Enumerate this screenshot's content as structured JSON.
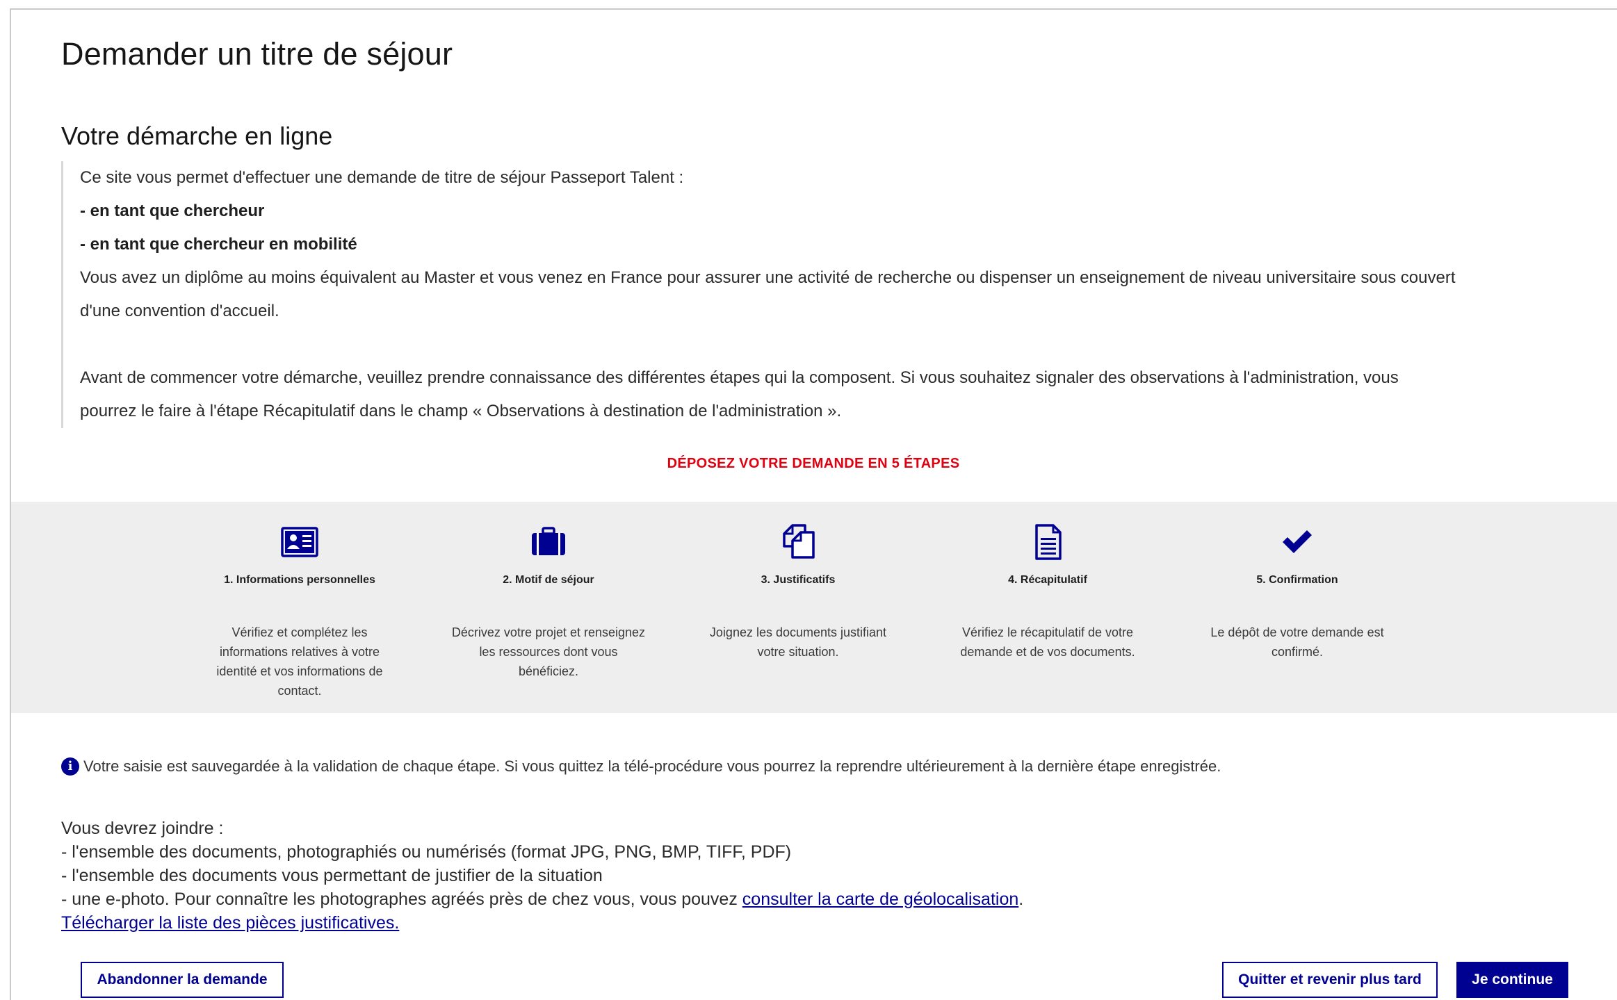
{
  "page": {
    "title": "Demander un titre de séjour",
    "section_title": "Votre démarche en ligne"
  },
  "intro": {
    "line1": "Ce site vous permet d'effectuer une demande de titre de séjour Passeport Talent :",
    "line2": "- en tant que chercheur",
    "line3": "- en tant que chercheur en mobilité",
    "line4": "Vous avez un diplôme au moins équivalent au Master et vous venez en France pour assurer une activité de recherche ou dispenser un enseignement de niveau universitaire sous couvert",
    "line5": "d'une convention d'accueil.",
    "line6": "Avant de commencer votre démarche, veuillez prendre connaissance des différentes étapes qui la composent. Si vous souhaitez signaler des observations à l'administration, vous",
    "line7": "pourrez le faire à l'étape Récapitulatif dans le champ « Observations à destination de l'administration »."
  },
  "steps_heading": "DÉPOSEZ VOTRE DEMANDE EN 5 ÉTAPES",
  "steps": [
    {
      "icon": "id-card-icon",
      "label": "1. Informations personnelles",
      "desc": "Vérifiez et complétez les informations relatives à votre identité et vos informations de contact."
    },
    {
      "icon": "briefcase-icon",
      "label": "2. Motif de séjour",
      "desc": "Décrivez votre projet et renseignez les ressources dont vous bénéficiez."
    },
    {
      "icon": "documents-icon",
      "label": "3. Justificatifs",
      "desc": "Joignez les documents justifiant votre situation."
    },
    {
      "icon": "document-icon",
      "label": "4. Récapitulatif",
      "desc": "Vérifiez le récapitulatif de votre demande et de vos documents."
    },
    {
      "icon": "checkmark-icon",
      "label": "5. Confirmation",
      "desc": "Le dépôt de votre demande est confirmé."
    }
  ],
  "info": {
    "icon": "info-icon",
    "text": "Votre saisie est sauvegardée à la validation de chaque étape. Si vous quittez la télé-procédure vous pourrez la reprendre ultérieurement à la dernière étape enregistrée."
  },
  "join": {
    "heading": "Vous devrez joindre :",
    "item1": "- l'ensemble des documents, photographiés ou numérisés (format JPG, PNG, BMP, TIFF, PDF)",
    "item2": "- l'ensemble des documents vous permettant de justifier de la situation",
    "item3_prefix": "- une e-photo. Pour connaître les photographes agréés près de chez vous, vous pouvez ",
    "item3_link": "consulter la carte de géolocalisation",
    "item3_suffix": ".",
    "download_link": "Télécharger la liste des pièces justificatives."
  },
  "buttons": {
    "abandon": "Abandonner la demande",
    "quit": "Quitter et revenir plus tard",
    "continue": "Je continue"
  },
  "colors": {
    "primary": "#000091",
    "accent_red": "#e1000f",
    "band": "#eeeeee"
  }
}
